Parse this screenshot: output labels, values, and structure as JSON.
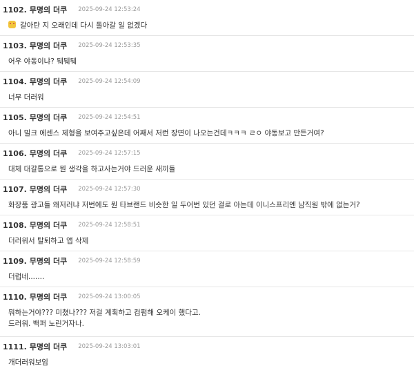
{
  "comments": [
    {
      "number": "1102.",
      "author": "무명의 더쿠",
      "date": "2025-09-24 12:53:24",
      "lines": [
        "갈아탄 지 오래인데 다시 돌아갈 일 없겠다"
      ],
      "icon": "grimace-emoji-icon"
    },
    {
      "number": "1103.",
      "author": "무명의 더쿠",
      "date": "2025-09-24 12:53:35",
      "lines": [
        "어우 야동이냐? 퉤퉤퉤"
      ]
    },
    {
      "number": "1104.",
      "author": "무명의 더쿠",
      "date": "2025-09-24 12:54:09",
      "lines": [
        "너무 더러워"
      ]
    },
    {
      "number": "1105.",
      "author": "무명의 더쿠",
      "date": "2025-09-24 12:54:51",
      "lines": [
        "아니 밀크 에센스 제형을 보여주고싶은데 어째서 저런 장면이 나오는건데ㅋㅋㅋ ㄹㅇ 야동보고 만든거여?"
      ]
    },
    {
      "number": "1106.",
      "author": "무명의 더쿠",
      "date": "2025-09-24 12:57:15",
      "lines": [
        "대체 대갈통으로 뭔 생각을 하고사는거야 드러운 새끼들"
      ]
    },
    {
      "number": "1107.",
      "author": "무명의 더쿠",
      "date": "2025-09-24 12:57:30",
      "lines": [
        "화장품 광고들 왜저러냐 저번에도 뭔 타브랜드 비슷한 일 두어번 있던 걸로 아는데 이니스프리엔 남직원 밖에 없는거?"
      ]
    },
    {
      "number": "1108.",
      "author": "무명의 더쿠",
      "date": "2025-09-24 12:58:51",
      "lines": [
        "더러워서 탈퇴하고 앱 삭제"
      ]
    },
    {
      "number": "1109.",
      "author": "무명의 더쿠",
      "date": "2025-09-24 12:58:59",
      "lines": [
        "더럽네......."
      ]
    },
    {
      "number": "1110.",
      "author": "무명의 더쿠",
      "date": "2025-09-24 13:00:05",
      "lines": [
        "뭐하는거야??? 미쳤나??? 저걸 계획하고 컴펌해 오케이 했다고.",
        "드러워. 백퍼 노린거자나."
      ]
    },
    {
      "number": "1111.",
      "author": "무명의 더쿠",
      "date": "2025-09-24 13:03:01",
      "lines": [
        "개더러워보임"
      ]
    }
  ]
}
